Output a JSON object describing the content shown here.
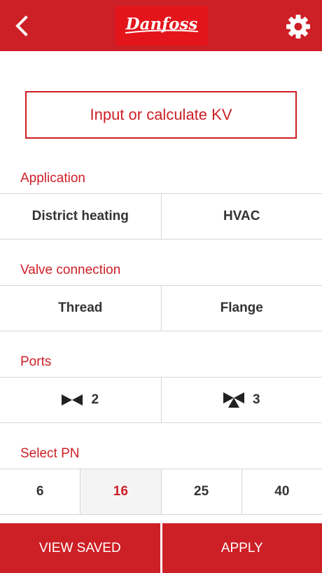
{
  "header": {
    "back_icon": "chevron-left-icon",
    "logo_text": "Danfoss",
    "settings_icon": "gear-icon"
  },
  "kv_button": {
    "label": "Input or calculate KV"
  },
  "application": {
    "label": "Application",
    "options": [
      "District heating",
      "HVAC"
    ]
  },
  "valve_connection": {
    "label": "Valve connection",
    "options": [
      "Thread",
      "Flange"
    ]
  },
  "ports": {
    "label": "Ports",
    "options": [
      {
        "value": "2",
        "icon": "two-way-valve-icon"
      },
      {
        "value": "3",
        "icon": "three-way-valve-icon"
      }
    ]
  },
  "pn": {
    "label": "Select PN",
    "options": [
      "6",
      "16",
      "25",
      "40"
    ],
    "selected": "16"
  },
  "footer": {
    "view_saved_label": "VIEW SAVED",
    "apply_label": "APPLY"
  },
  "colors": {
    "brand_red": "#cd1f26",
    "logo_red": "#e4141b",
    "text_dark": "#333333",
    "divider": "#d6d6d6",
    "selected_bg": "#f4f4f4"
  }
}
